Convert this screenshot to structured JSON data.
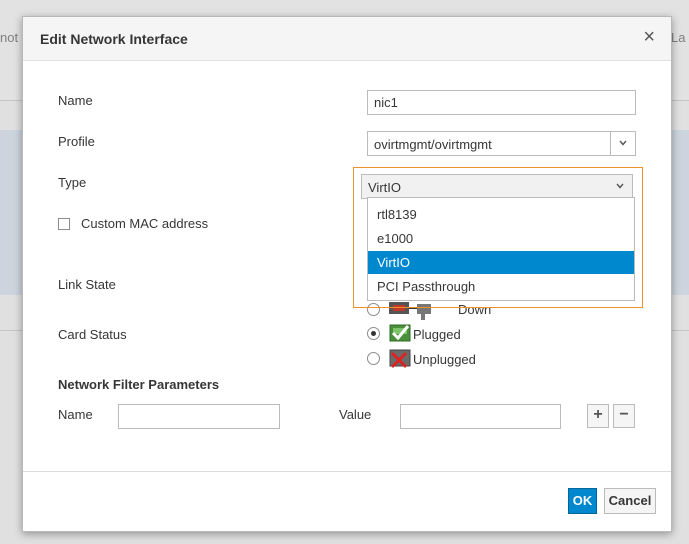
{
  "background": {
    "left_fragment": "not",
    "right_fragment": "La"
  },
  "modal": {
    "title": "Edit Network Interface",
    "close_symbol": "×"
  },
  "form": {
    "name_label": "Name",
    "name_value": "nic1",
    "profile_label": "Profile",
    "profile_value": "ovirtmgmt/ovirtmgmt",
    "type_label": "Type",
    "type_value": "VirtIO",
    "custom_mac_label": "Custom MAC address",
    "custom_mac_checked": false,
    "link_state_label": "Link State",
    "link_state_down_label": "Down",
    "card_status_label": "Card Status",
    "card_status_options": [
      "Plugged",
      "Unplugged"
    ],
    "card_status_selected": "Plugged"
  },
  "type_dropdown": {
    "options": [
      "rtl8139",
      "e1000",
      "VirtIO",
      "PCI Passthrough"
    ],
    "selected": "VirtIO"
  },
  "filter_params": {
    "heading": "Network Filter Parameters",
    "name_label": "Name",
    "name_value": "",
    "value_label": "Value",
    "value_value": "",
    "add_symbol": "+",
    "remove_symbol": "−"
  },
  "footer": {
    "ok_label": "OK",
    "cancel_label": "Cancel"
  },
  "colors": {
    "accent": "#0088ce",
    "dropdown_highlight_border": "#f0902a",
    "plugged_icon": "#3c9a2e",
    "unplugged_icon": "#cc2020"
  },
  "icons": {
    "close": "close-icon",
    "caret": "chevron-down-icon",
    "plugged": "nic-plugged-icon",
    "unplugged": "nic-unplugged-icon",
    "link_down": "link-down-icon"
  }
}
